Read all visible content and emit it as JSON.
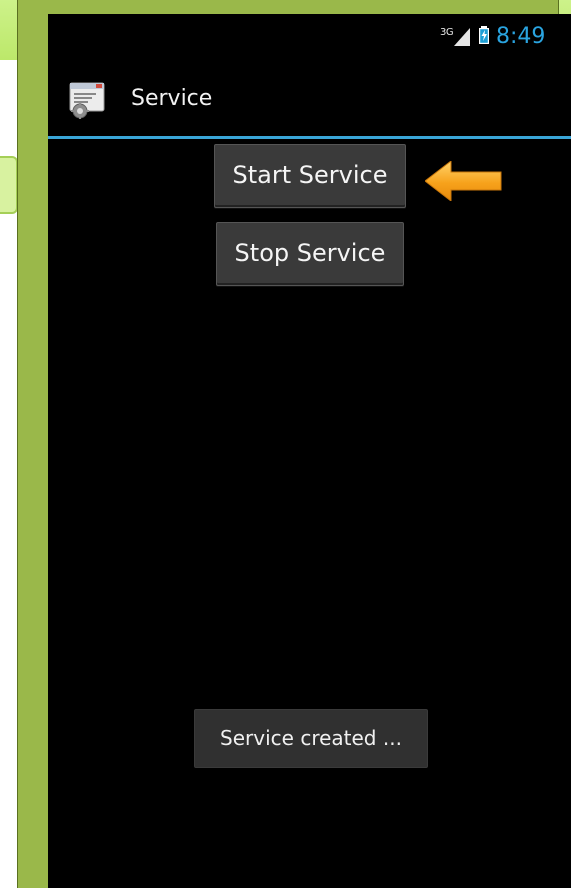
{
  "status_bar": {
    "network_type": "3G",
    "clock": "8:49",
    "battery_state": "charging"
  },
  "app": {
    "title": "Service",
    "icon": "app-window-gear-icon"
  },
  "buttons": {
    "start_label": "Start Service",
    "stop_label": "Stop Service"
  },
  "annotation": {
    "arrow": "orange-arrow-icon"
  },
  "toast": {
    "message": "Service created ..."
  },
  "colors": {
    "accent": "#3aa6d8",
    "arrow": "#f7a21b",
    "background": "#000000",
    "button": "#3a3a3a"
  }
}
